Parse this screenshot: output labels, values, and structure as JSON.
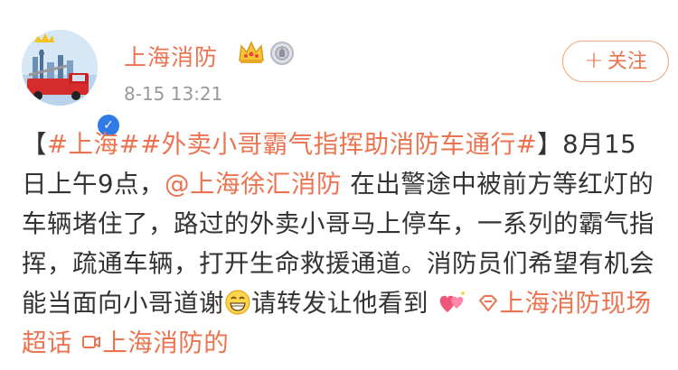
{
  "user": {
    "name": "上海消防",
    "time": "8-15 13:21",
    "verified_mark": "✓"
  },
  "follow_button": {
    "plus": "+",
    "label": "关注"
  },
  "post": {
    "open_bracket": "【",
    "topic": "#上海##外卖小哥霸气指挥助消防车通行#",
    "close_bracket": "】",
    "text1": "8月15日上午9点，",
    "mention": "@上海徐汇消防",
    "text2": " 在出警途中被前方等红灯的车辆堵住了，路过的外卖小哥马上停车，一系列的霸气指挥，疏通车辆，打开生命救援通道。消防员们希望有机会能当面向小哥道谢",
    "text3": "请转发让他看到",
    "link1": "上海消防现场超话",
    "link2": "上海消防的"
  },
  "colors": {
    "accent": "#eb7350",
    "text": "#333333",
    "muted": "#999999",
    "verified": "#2f7ae5"
  }
}
